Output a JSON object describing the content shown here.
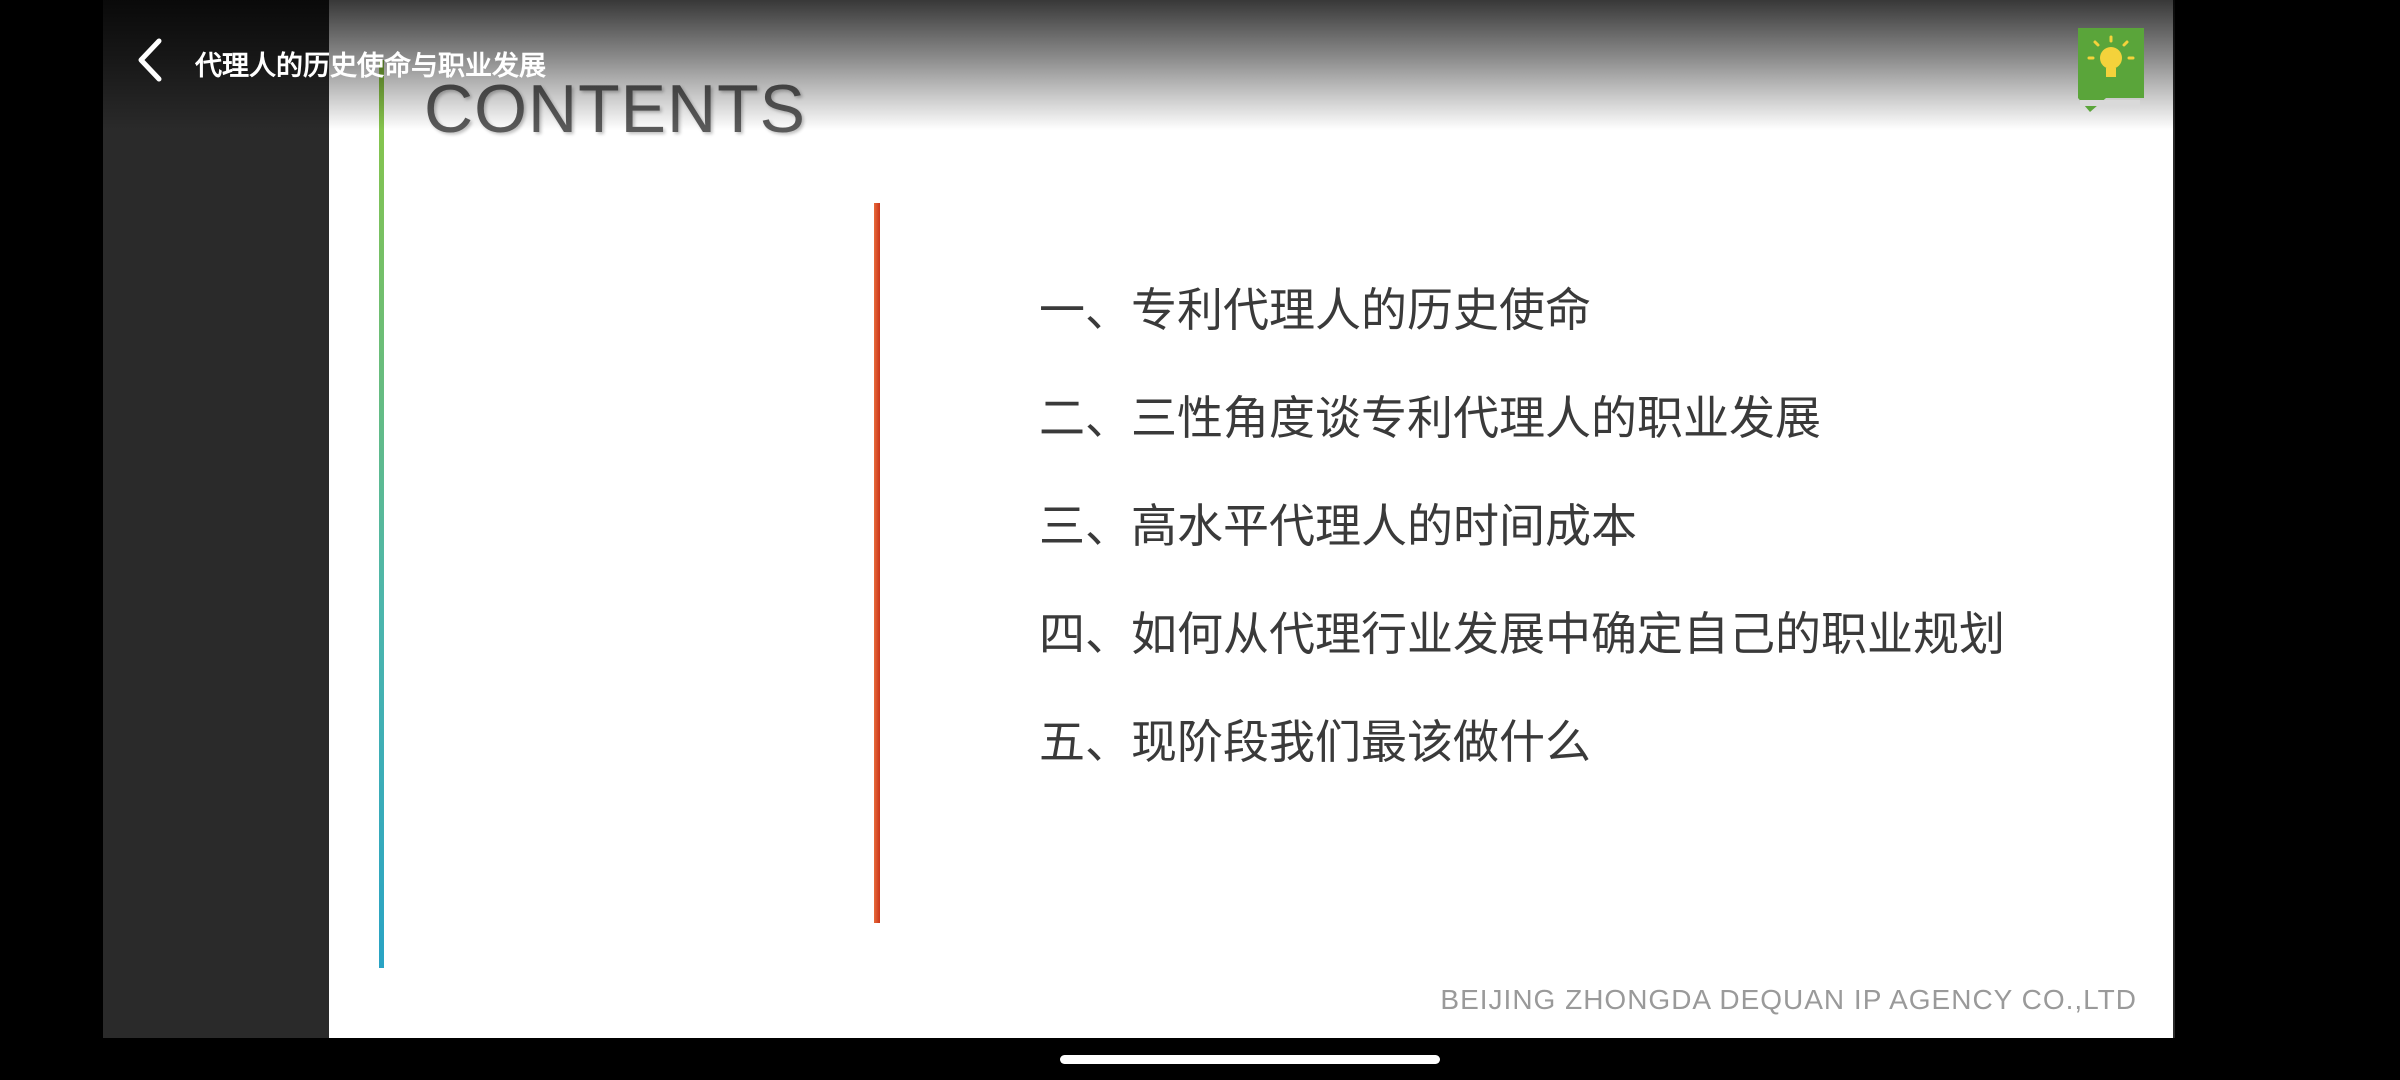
{
  "video_header": {
    "title": "代理人的历史使命与职业发展",
    "back_icon": "chevron-left-icon"
  },
  "slide": {
    "heading": "CONTENTS",
    "items": [
      "一、专利代理人的历史使命",
      "二、三性角度谈专利代理人的职业发展",
      "三、高水平代理人的时间成本",
      "四、如何从代理行业发展中确定自己的职业规划",
      "五、现阶段我们最该做什么"
    ],
    "footer": "BEIJING ZHONGDA  DEQUAN  IP AGENCY  CO.,LTD",
    "logo_icon": "lightbulb-icon"
  },
  "colors": {
    "left_line_top": "#8dc63f",
    "left_line_bottom": "#29a3c4",
    "divider_red": "#d0401f",
    "logo_green": "#5aa53a"
  }
}
